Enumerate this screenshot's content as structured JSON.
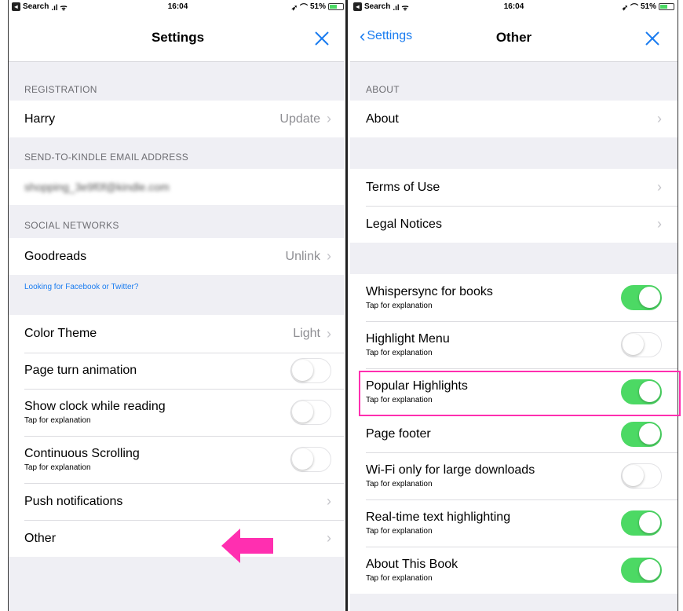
{
  "status_bar": {
    "carrier": "Search",
    "time": "16:04",
    "battery": "51%"
  },
  "left": {
    "nav_title": "Settings",
    "sections": {
      "registration_header": "REGISTRATION",
      "registration_name": "Harry",
      "registration_detail": "Update",
      "email_header": "SEND-TO-KINDLE EMAIL ADDRESS",
      "email_value": "shopping_3e9f0f@kindle.com",
      "social_header": "SOCIAL NETWORKS",
      "goodreads_label": "Goodreads",
      "goodreads_detail": "Unlink",
      "social_note": "Looking for Facebook or Twitter?",
      "color_theme_label": "Color Theme",
      "color_theme_value": "Light",
      "page_turn_label": "Page turn animation",
      "show_clock_label": "Show clock while reading",
      "show_clock_sub": "Tap for explanation",
      "continuous_label": "Continuous Scrolling",
      "continuous_sub": "Tap for explanation",
      "push_label": "Push notifications",
      "other_label": "Other"
    },
    "toggles": {
      "page_turn": false,
      "show_clock": false,
      "continuous": false
    }
  },
  "right": {
    "nav_back": "Settings",
    "nav_title": "Other",
    "about_header": "ABOUT",
    "about_label": "About",
    "terms_label": "Terms of Use",
    "legal_label": "Legal Notices",
    "items": [
      {
        "label": "Whispersync for books",
        "sub": "Tap for explanation",
        "on": true
      },
      {
        "label": "Highlight Menu",
        "sub": "Tap for explanation",
        "on": false
      },
      {
        "label": "Popular Highlights",
        "sub": "Tap for explanation",
        "on": true
      },
      {
        "label": "Page footer",
        "sub": "",
        "on": true
      },
      {
        "label": "Wi-Fi only for large downloads",
        "sub": "Tap for explanation",
        "on": false
      },
      {
        "label": "Real-time text highlighting",
        "sub": "Tap for explanation",
        "on": true
      },
      {
        "label": "About This Book",
        "sub": "Tap for explanation",
        "on": true
      }
    ]
  },
  "colors": {
    "accent": "#1a7cf0",
    "toggle_on": "#4cd964",
    "annotation": "#ff2fb0"
  },
  "icons": {
    "close": "close-icon",
    "chevron": "chevron-right-icon",
    "back": "chevron-left-icon",
    "annotation_arrow": "left-arrow-annotation"
  }
}
